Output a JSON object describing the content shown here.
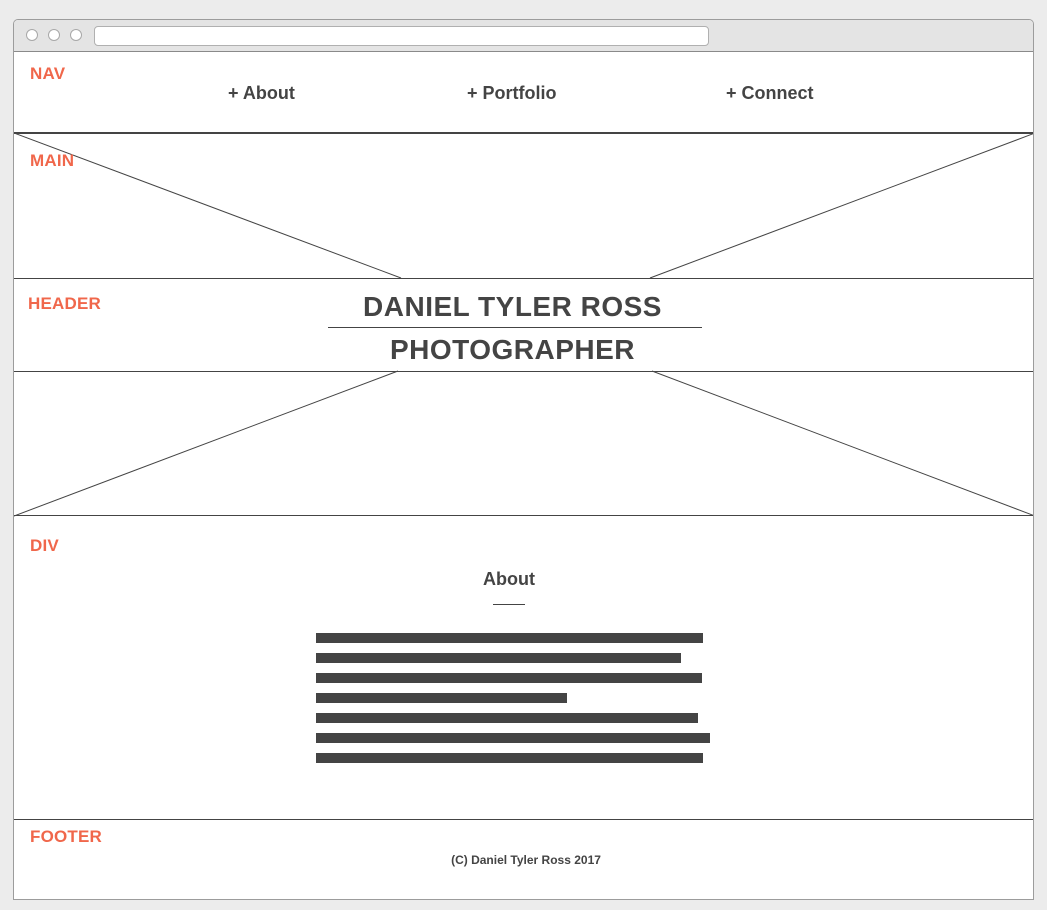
{
  "sections": {
    "nav": "NAV",
    "main": "MAIN",
    "header": "HEADER",
    "div": "DIV",
    "footer": "FOOTER"
  },
  "nav": {
    "items": [
      {
        "label": "+ About"
      },
      {
        "label": "+ Portfolio"
      },
      {
        "label": "+ Connect"
      }
    ]
  },
  "header": {
    "name": "DANIEL TYLER ROSS",
    "role": "PHOTOGRAPHER"
  },
  "about": {
    "title": "About"
  },
  "footer": {
    "copyright": "(C) Daniel Tyler Ross 2017"
  },
  "colors": {
    "label": "#f0674b",
    "text": "#444444"
  }
}
